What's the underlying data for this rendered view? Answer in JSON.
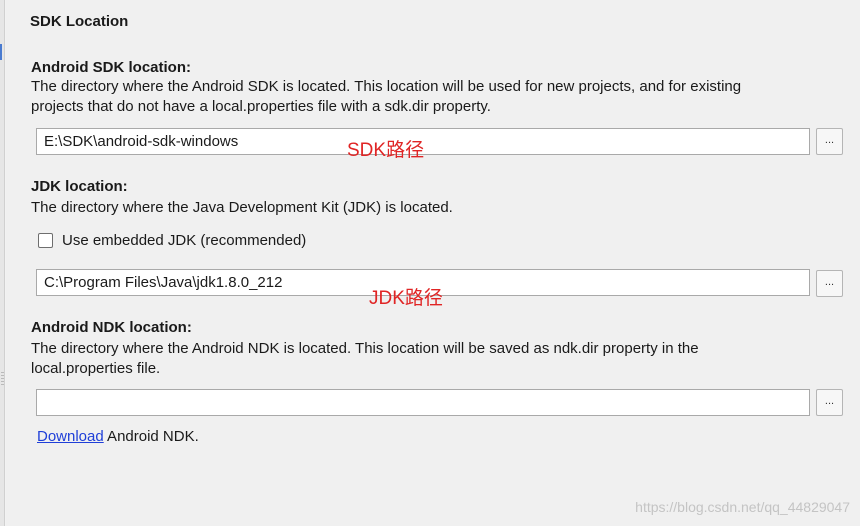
{
  "panel": {
    "title": "SDK Location"
  },
  "android_sdk": {
    "heading": "Android SDK location:",
    "desc_line1": "The directory where the Android SDK is located. This location will be used for new projects, and for existing",
    "desc_line2": "projects that do not have a local.properties file with a sdk.dir property.",
    "path_value": "E:\\SDK\\android-sdk-windows",
    "browse_label": "...",
    "annotation": "SDK路径"
  },
  "jdk": {
    "heading": "JDK location:",
    "desc": "The directory where the Java Development Kit (JDK) is located.",
    "embedded_label": "Use embedded JDK (recommended)",
    "embedded_checked": false,
    "path_value": "C:\\Program Files\\Java\\jdk1.8.0_212",
    "browse_label": "...",
    "annotation": "JDK路径"
  },
  "ndk": {
    "heading": "Android NDK location:",
    "desc_line1": "The directory where the Android NDK is located. This location will be saved as ndk.dir property in the",
    "desc_line2": "local.properties file.",
    "path_value": "",
    "browse_label": "...",
    "download_link": "Download",
    "download_suffix": " Android NDK."
  },
  "watermark": "https://blog.csdn.net/qq_44829047",
  "colors": {
    "annotation": "#e02525",
    "link": "#1f3fd8"
  }
}
